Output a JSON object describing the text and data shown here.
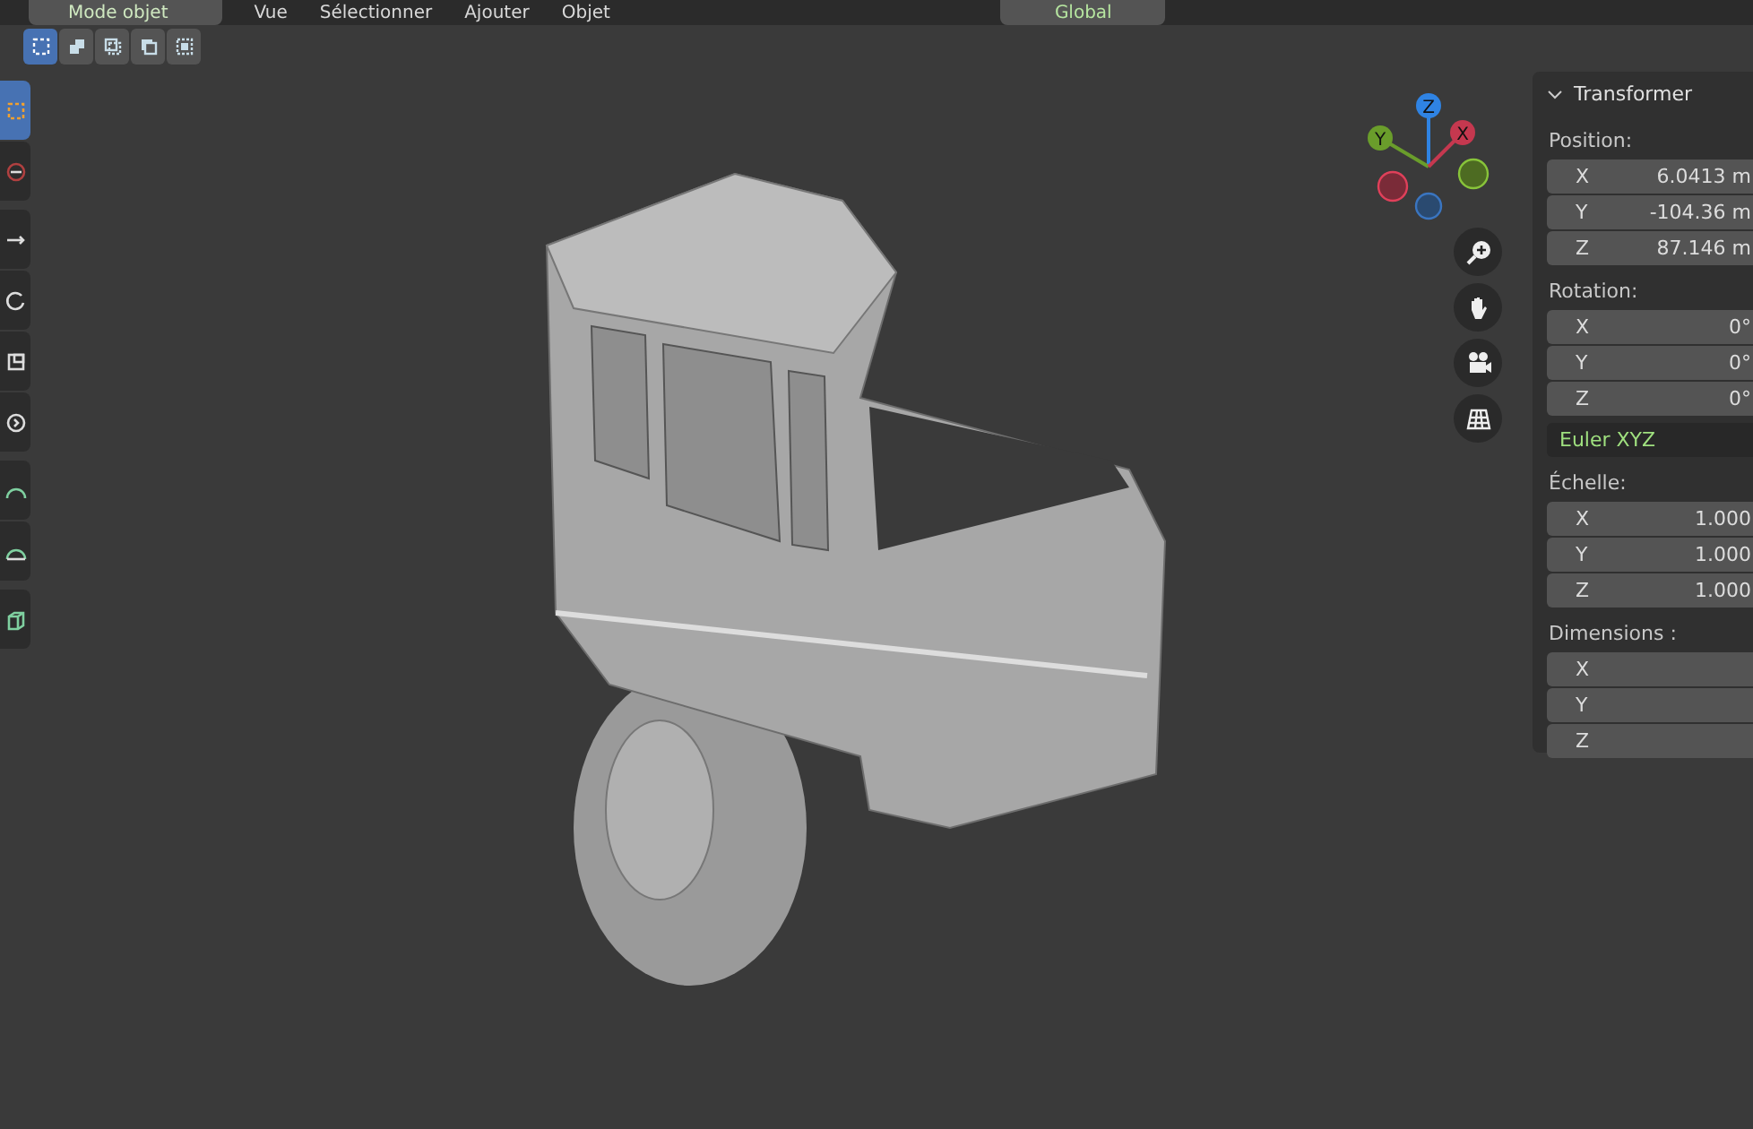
{
  "header": {
    "mode": "Mode objet",
    "menus": [
      "Vue",
      "Sélectionner",
      "Ajouter",
      "Objet"
    ],
    "orientation": "Global"
  },
  "select_modes": [
    {
      "selected": true
    },
    {
      "selected": false
    },
    {
      "selected": false
    },
    {
      "selected": false
    },
    {
      "selected": false
    }
  ],
  "toolbar": [
    {
      "selected": true
    },
    {
      "selected": false
    },
    {
      "selected": false
    },
    {
      "selected": false
    },
    {
      "selected": false
    },
    {
      "selected": false
    },
    {
      "selected": false
    },
    {
      "selected": false
    },
    {
      "selected": false
    }
  ],
  "gizmo": {
    "axes": [
      "Z",
      "Y",
      "X"
    ]
  },
  "panel": {
    "title": "Transformer",
    "position": {
      "label": "Position:",
      "fields": [
        {
          "axis": "X",
          "value": "6.0413 m"
        },
        {
          "axis": "Y",
          "value": "-104.36 m"
        },
        {
          "axis": "Z",
          "value": "87.146 m"
        }
      ]
    },
    "rotation": {
      "label": "Rotation:",
      "fields": [
        {
          "axis": "X",
          "value": "0°"
        },
        {
          "axis": "Y",
          "value": "0°"
        },
        {
          "axis": "Z",
          "value": "0°"
        }
      ],
      "mode": "Euler XYZ"
    },
    "scale": {
      "label": "Échelle:",
      "fields": [
        {
          "axis": "X",
          "value": "1.000"
        },
        {
          "axis": "Y",
          "value": "1.000"
        },
        {
          "axis": "Z",
          "value": "1.000"
        }
      ]
    },
    "dimensions": {
      "label": "Dimensions  :",
      "fields": [
        {
          "axis": "X"
        },
        {
          "axis": "Y"
        },
        {
          "axis": "Z"
        }
      ]
    }
  }
}
